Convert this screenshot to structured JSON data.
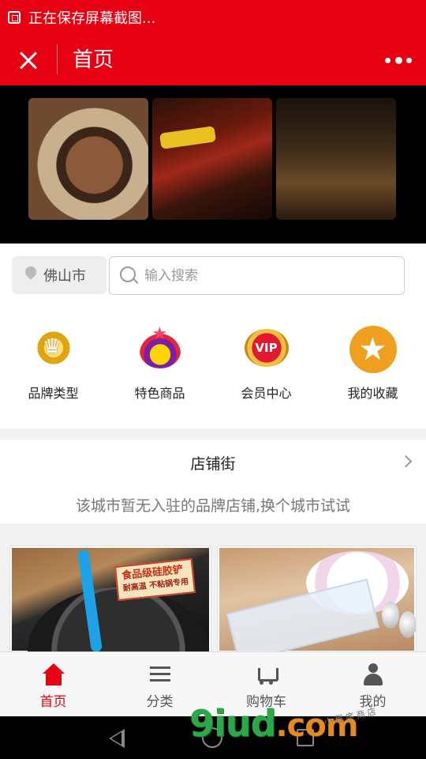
{
  "status_bar": {
    "text": "正在保存屏幕截图..."
  },
  "title_bar": {
    "title": "首页"
  },
  "location": {
    "city": "佛山市"
  },
  "search": {
    "placeholder": "输入搜索"
  },
  "menu": {
    "items": [
      {
        "label": "品牌类型",
        "icon": "crown-icon"
      },
      {
        "label": "特色商品",
        "icon": "special-badge-icon"
      },
      {
        "label": "会员中心",
        "icon": "vip-badge-icon"
      },
      {
        "label": "我的收藏",
        "icon": "star-icon"
      }
    ]
  },
  "shop_street": {
    "title": "店铺街",
    "empty_message": "该城市暂无入驻的品牌店铺,换个城市试试"
  },
  "products": {
    "items": [
      {
        "badge_text": "食品级硅胶铲",
        "badge_sub": "耐高温 不粘锅专用",
        "image": "wok-with-spatula"
      },
      {
        "image": "plate-and-spoons"
      }
    ]
  },
  "tabbar": {
    "tabs": [
      {
        "label": "首页",
        "icon": "home-icon",
        "active": true
      },
      {
        "label": "分类",
        "icon": "list-icon",
        "active": false
      },
      {
        "label": "购物车",
        "icon": "cart-icon",
        "active": false
      },
      {
        "label": "我的",
        "icon": "user-icon",
        "active": false
      }
    ]
  },
  "watermark": {
    "main": "9iud",
    "suffix": ".com",
    "small": "小程序商店"
  },
  "colors": {
    "brand_red": "#e60012",
    "background": "#f2f2f2",
    "text_dark": "#222222",
    "text_muted": "#777777"
  }
}
